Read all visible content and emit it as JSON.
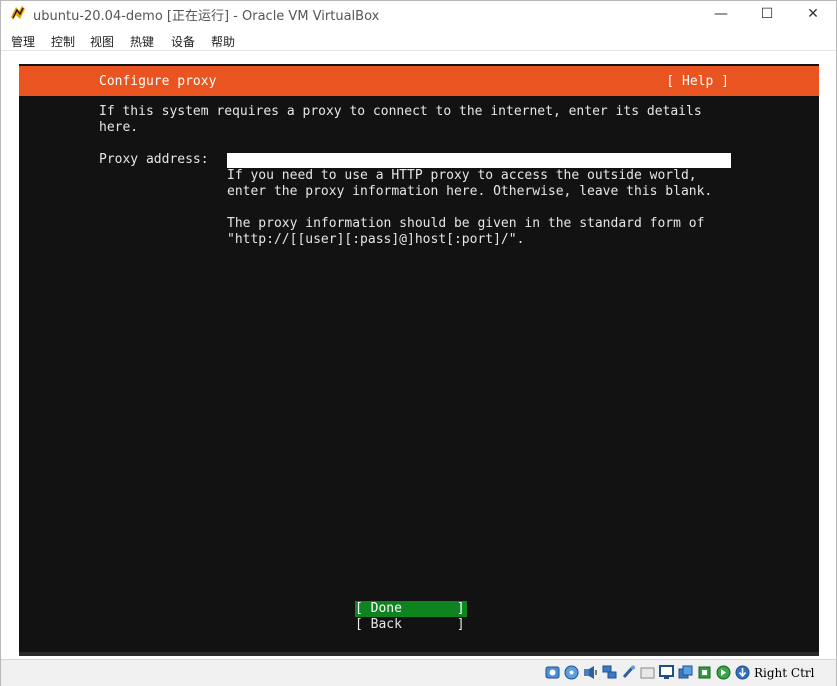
{
  "window": {
    "title": "ubuntu-20.04-demo [正在运行] - Oracle VM VirtualBox",
    "minimize_glyph": "—",
    "maximize_glyph": "☐",
    "close_glyph": "✕"
  },
  "menu": [
    "管理",
    "控制",
    "视图",
    "热键",
    "设备",
    "帮助"
  ],
  "installer": {
    "header_title": "Configure proxy",
    "help_label": "[ Help ]",
    "intro_line1": "If this system requires a proxy to connect to the internet, enter its details",
    "intro_line2": "here.",
    "proxy_label": "Proxy address:",
    "proxy_value": "",
    "hint_line1": "If you need to use a HTTP proxy to access the outside world,",
    "hint_line2": "enter the proxy information here. Otherwise, leave this blank.",
    "hint_line3": "The proxy information should be given in the standard form of",
    "hint_line4": "\"http://[[user][:pass]@]host[:port]/\".",
    "done_label": "[ Done       ]",
    "back_label": "[ Back       ]"
  },
  "statusbar": {
    "host_key": "Right Ctrl",
    "icons": [
      "hard-disk-icon",
      "optical-drive-icon",
      "audio-icon",
      "network-icon",
      "usb-icon",
      "shared-folders-icon",
      "display-icon",
      "video-capture-icon",
      "cpu-icon",
      "mouse-integration-icon",
      "keyboard-icon"
    ]
  },
  "colors": {
    "header_orange": "#e95420",
    "console_bg": "#121212",
    "button_green": "#0e8420"
  }
}
